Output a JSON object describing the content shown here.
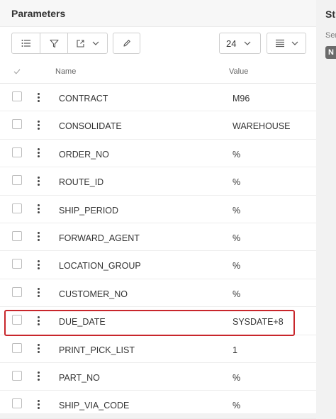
{
  "panel": {
    "title": "Parameters"
  },
  "toolbar": {
    "page_size": "24"
  },
  "table": {
    "columns": {
      "name": "Name",
      "value": "Value"
    },
    "rows": [
      {
        "name": "CONTRACT",
        "value": "M96"
      },
      {
        "name": "CONSOLIDATE",
        "value": "WAREHOUSE"
      },
      {
        "name": "ORDER_NO",
        "value": "%"
      },
      {
        "name": "ROUTE_ID",
        "value": "%"
      },
      {
        "name": "SHIP_PERIOD",
        "value": "%"
      },
      {
        "name": "FORWARD_AGENT",
        "value": "%"
      },
      {
        "name": "LOCATION_GROUP",
        "value": "%"
      },
      {
        "name": "CUSTOMER_NO",
        "value": "%"
      },
      {
        "name": "DUE_DATE",
        "value": "SYSDATE+8"
      },
      {
        "name": "PRINT_PICK_LIST",
        "value": "1"
      },
      {
        "name": "PART_NO",
        "value": "%"
      },
      {
        "name": "SHIP_VIA_CODE",
        "value": "%"
      }
    ]
  },
  "side_panel": {
    "title": "Stru",
    "label": "Ser",
    "badge": "N"
  },
  "colors": {
    "highlight": "#c8262b",
    "badge": "#6b6b6b"
  }
}
